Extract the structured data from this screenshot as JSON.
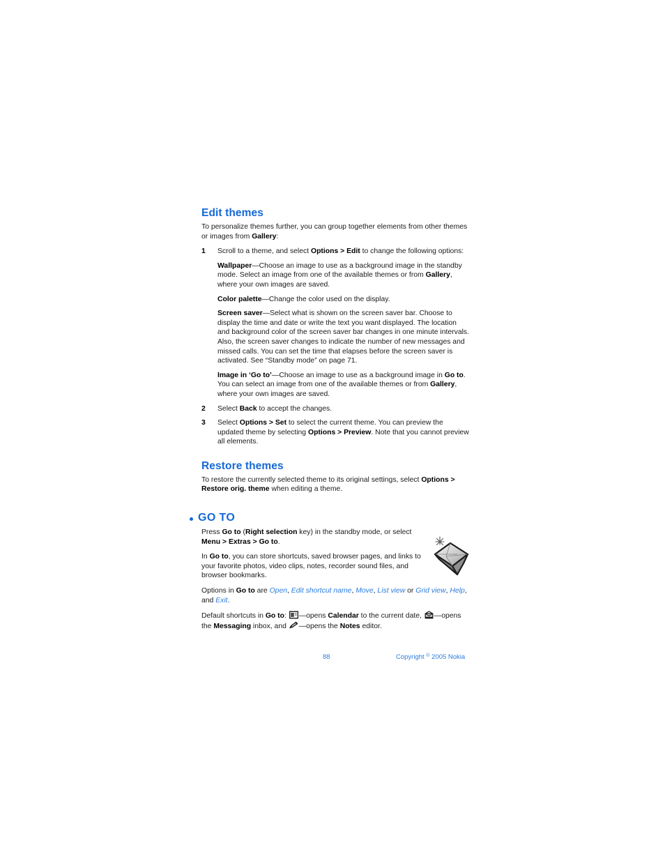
{
  "page": {
    "background": "#ffffff",
    "heading_color": "#1569d6",
    "link_color": "#2b7de0",
    "body_color": "#1a1a1a"
  },
  "sections": {
    "edit_themes": {
      "heading": "Edit themes",
      "intro_a": "To personalize themes further, you can group together elements from other themes or images from ",
      "intro_b": "Gallery",
      "intro_c": ":",
      "step1": {
        "number": "1",
        "t1": "Scroll to a theme, and select ",
        "t2": "Options > Edit",
        "t3": " to change the following options:"
      },
      "wallpaper": {
        "term": "Wallpaper",
        "t1": "—Choose an image to use as a background image in the standby mode. Select an image from one of the available themes or from ",
        "t2": "Gallery",
        "t3": ", where your own images are saved."
      },
      "color_palette": {
        "term": "Color palette",
        "t1": "—Change the color used on the display."
      },
      "screen_saver": {
        "term": "Screen saver",
        "t1": "—Select what is shown on the screen saver bar. Choose to display the time and date or write the text you want displayed. The location and background color of the screen saver bar changes in one minute intervals. Also, the screen saver changes to indicate the number of new messages and missed calls. You can set the time that elapses before the screen saver is activated. See “Standby mode” on page 71."
      },
      "image_in_goto": {
        "term": "Image in ‘Go to’",
        "t1": "—Choose an image to use as a background image in ",
        "t2": "Go to",
        "t3": ". You can select an image from one of the available themes or from ",
        "t4": "Gallery",
        "t5": ", where your own images are saved."
      },
      "step2": {
        "number": "2",
        "t1": "Select ",
        "t2": "Back",
        "t3": " to accept the changes."
      },
      "step3": {
        "number": "3",
        "t1": "Select ",
        "t2": "Options > Set",
        "t3": " to select the current theme. You can preview the updated theme by selecting ",
        "t4": "Options > Preview",
        "t5": ". Note that you cannot preview all elements."
      }
    },
    "restore_themes": {
      "heading": "Restore themes",
      "t1": "To restore the currently selected theme to its original settings, select ",
      "t2": "Options > Restore orig. theme",
      "t3": " when editing a theme."
    },
    "go_to": {
      "heading": "GO TO",
      "bullet_icon": "bullet-dot-icon",
      "illustration_icon": "diamond-gem-icon",
      "press": {
        "t1": "Press ",
        "t2": "Go to",
        "t3": " (",
        "t4": "Right selection",
        "t5": " key) in the standby mode, or select ",
        "t6": "Menu > Extras > Go to",
        "t7": "."
      },
      "store": {
        "t1": "In ",
        "t2": "Go to",
        "t3": ", you can store shortcuts, saved browser pages, and links to your favorite photos, video clips, notes, recorder sound files, and browser bookmarks."
      },
      "options": {
        "t1": "Options in ",
        "t2": "Go to",
        "t3": " are ",
        "list": [
          "Open",
          "Edit shortcut name",
          "Move",
          "List view",
          "Grid view",
          "Help",
          "Exit"
        ],
        "sep1": ", ",
        "sep_or": " or ",
        "sep_and": ", and ",
        "end": "."
      },
      "shortcuts": {
        "t1": "Default shortcuts in ",
        "t2": "Go to",
        "t3": ": ",
        "icon1": "calendar-icon",
        "t4": "—opens ",
        "t5": "Calendar",
        "t6": " to the current date, ",
        "icon2": "messaging-envelope-icon",
        "t7": "—opens the ",
        "t8": "Messaging",
        "t9": " inbox, and ",
        "icon3": "notes-pencil-icon",
        "t10": "—opens the ",
        "t11": "Notes",
        "t12": " editor."
      }
    }
  },
  "footer": {
    "page_number": "88",
    "copyright_pre": "Copyright ",
    "copyright_symbol": "©",
    "copyright_post": " 2005 Nokia"
  }
}
